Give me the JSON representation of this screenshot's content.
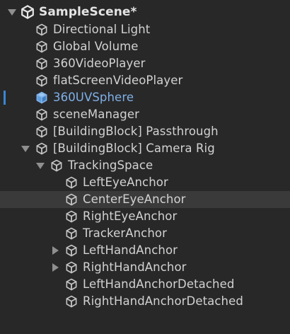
{
  "scene": {
    "title": "SampleScene*",
    "icon": "unity-logo-icon"
  },
  "items": [
    {
      "label": "Directional Light",
      "icon": "gameobject-cube-icon",
      "depth": 1,
      "fold": "none",
      "selected": false
    },
    {
      "label": "Global Volume",
      "icon": "gameobject-cube-icon",
      "depth": 1,
      "fold": "none",
      "selected": false
    },
    {
      "label": "360VideoPlayer",
      "icon": "gameobject-cube-icon",
      "depth": 1,
      "fold": "none",
      "selected": false
    },
    {
      "label": "flatScreenVideoPlayer",
      "icon": "gameobject-cube-icon",
      "depth": 1,
      "fold": "none",
      "selected": false
    },
    {
      "label": "360UVSphere",
      "icon": "gameobject-cube-icon-blue",
      "depth": 1,
      "fold": "none",
      "selected": true
    },
    {
      "label": "sceneManager",
      "icon": "gameobject-cube-icon",
      "depth": 1,
      "fold": "none",
      "selected": false
    },
    {
      "label": "[BuildingBlock] Passthrough",
      "icon": "gameobject-cube-icon",
      "depth": 1,
      "fold": "none",
      "selected": false
    },
    {
      "label": "[BuildingBlock] Camera Rig",
      "icon": "gameobject-cube-icon",
      "depth": 1,
      "fold": "expanded",
      "selected": false
    },
    {
      "label": "TrackingSpace",
      "icon": "gameobject-cube-icon",
      "depth": 2,
      "fold": "expanded",
      "selected": false
    },
    {
      "label": "LeftEyeAnchor",
      "icon": "gameobject-cube-icon",
      "depth": 3,
      "fold": "none",
      "selected": false
    },
    {
      "label": "CenterEyeAnchor",
      "icon": "gameobject-cube-icon",
      "depth": 3,
      "fold": "none",
      "selected": false,
      "hover": true
    },
    {
      "label": "RightEyeAnchor",
      "icon": "gameobject-cube-icon",
      "depth": 3,
      "fold": "none",
      "selected": false
    },
    {
      "label": "TrackerAnchor",
      "icon": "gameobject-cube-icon",
      "depth": 3,
      "fold": "none",
      "selected": false
    },
    {
      "label": "LeftHandAnchor",
      "icon": "gameobject-cube-icon",
      "depth": 3,
      "fold": "collapsed",
      "selected": false
    },
    {
      "label": "RightHandAnchor",
      "icon": "gameobject-cube-icon",
      "depth": 3,
      "fold": "collapsed",
      "selected": false
    },
    {
      "label": "LeftHandAnchorDetached",
      "icon": "gameobject-cube-icon",
      "depth": 3,
      "fold": "none",
      "selected": false
    },
    {
      "label": "RightHandAnchorDetached",
      "icon": "gameobject-cube-icon",
      "depth": 3,
      "fold": "none",
      "selected": false
    }
  ],
  "colors": {
    "background": "#282828",
    "text": "#d2d2d2",
    "selected_text": "#7fb0e8",
    "selection_bar": "#3a86d6",
    "hover_row": "#3a3a3a",
    "icon_stroke": "#c4c4c4"
  }
}
